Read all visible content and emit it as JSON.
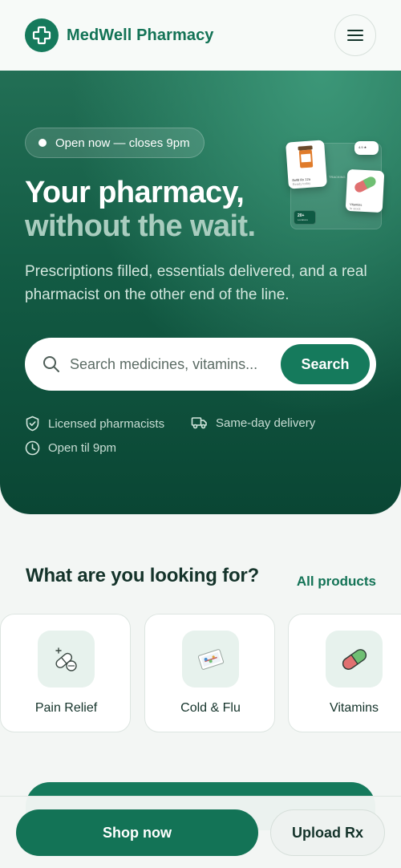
{
  "header": {
    "brand": "MedWell Pharmacy",
    "logo_icon": "medical-cross-icon",
    "menu_icon": "hamburger-menu-icon"
  },
  "hero": {
    "status": "Open now — closes 9pm",
    "headline_line1": "Your pharmacy,",
    "headline_line2": "without the wait.",
    "subtitle": "Prescriptions filled, essentials delivered, and a real pharmacist on the other end of the line.",
    "illustration": {
      "card1_line1": "Refill Rx 12a",
      "card1_line2": "Ready today",
      "badge": "20+",
      "badge_sub": "Locations",
      "chip": "4.9 ★",
      "card2_line1": "Vitamins",
      "card2_line2": "In stock",
      "mid_label": "TRACKING"
    }
  },
  "search": {
    "placeholder": "Search medicines, vitamins...",
    "button_label": "Search",
    "icon": "search-icon"
  },
  "features": [
    {
      "icon": "shield-check-icon",
      "label": "Licensed pharmacists"
    },
    {
      "icon": "delivery-truck-icon",
      "label": "Same-day delivery"
    },
    {
      "icon": "clock-icon",
      "label": "Open til 9pm"
    }
  ],
  "categories_section": {
    "title": "What are you looking for?",
    "link": "All products",
    "items": [
      {
        "label": "Pain Relief",
        "icon": "pills-icon"
      },
      {
        "label": "Cold & Flu",
        "icon": "thermometer-icon"
      },
      {
        "label": "Vitamins",
        "icon": "capsule-icon"
      }
    ]
  },
  "bottom_bar": {
    "primary": "Shop now",
    "secondary": "Upload Rx"
  },
  "colors": {
    "brand": "#157a5c",
    "hero_dark": "#0a4634",
    "background": "#f3f6f4"
  }
}
